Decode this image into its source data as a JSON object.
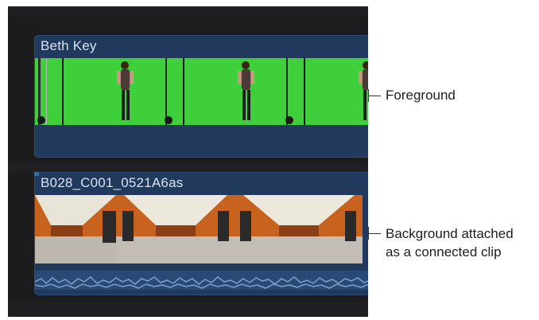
{
  "timeline": {
    "clips": [
      {
        "title": "Beth Key",
        "role": "foreground"
      },
      {
        "title": "B028_C001_0521A6as",
        "role": "background"
      }
    ]
  },
  "callouts": {
    "foreground": "Foreground",
    "background_line1": "Background attached",
    "background_line2": "as a connected clip"
  },
  "colors": {
    "timeline_bg": "#1c1c1e",
    "clip_bg": "#20395c",
    "clip_title": "#d6e2f2",
    "green_screen": "#3fcf3a",
    "station_orange": "#c8621f",
    "waveform": "#7f9fc9"
  }
}
